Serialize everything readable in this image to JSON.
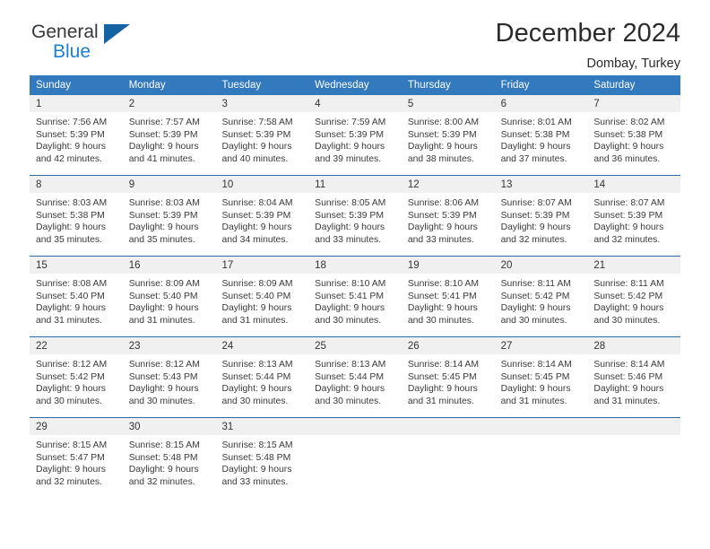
{
  "brand": {
    "name_top": "General",
    "name_bottom": "Blue",
    "accent_color": "#1b7fd4",
    "triangle_color": "#1464a5"
  },
  "header": {
    "title": "December 2024",
    "subtitle": "Dombay, Turkey"
  },
  "calendar": {
    "header_bg": "#3279bd",
    "row_border_color": "#2d6ca8",
    "daynum_bg": "#f0f0f0",
    "weekday_headers": [
      "Sunday",
      "Monday",
      "Tuesday",
      "Wednesday",
      "Thursday",
      "Friday",
      "Saturday"
    ],
    "weeks": [
      [
        {
          "day": "1",
          "sunrise": "Sunrise: 7:56 AM",
          "sunset": "Sunset: 5:39 PM",
          "daylight_1": "Daylight: 9 hours",
          "daylight_2": "and 42 minutes."
        },
        {
          "day": "2",
          "sunrise": "Sunrise: 7:57 AM",
          "sunset": "Sunset: 5:39 PM",
          "daylight_1": "Daylight: 9 hours",
          "daylight_2": "and 41 minutes."
        },
        {
          "day": "3",
          "sunrise": "Sunrise: 7:58 AM",
          "sunset": "Sunset: 5:39 PM",
          "daylight_1": "Daylight: 9 hours",
          "daylight_2": "and 40 minutes."
        },
        {
          "day": "4",
          "sunrise": "Sunrise: 7:59 AM",
          "sunset": "Sunset: 5:39 PM",
          "daylight_1": "Daylight: 9 hours",
          "daylight_2": "and 39 minutes."
        },
        {
          "day": "5",
          "sunrise": "Sunrise: 8:00 AM",
          "sunset": "Sunset: 5:39 PM",
          "daylight_1": "Daylight: 9 hours",
          "daylight_2": "and 38 minutes."
        },
        {
          "day": "6",
          "sunrise": "Sunrise: 8:01 AM",
          "sunset": "Sunset: 5:38 PM",
          "daylight_1": "Daylight: 9 hours",
          "daylight_2": "and 37 minutes."
        },
        {
          "day": "7",
          "sunrise": "Sunrise: 8:02 AM",
          "sunset": "Sunset: 5:38 PM",
          "daylight_1": "Daylight: 9 hours",
          "daylight_2": "and 36 minutes."
        }
      ],
      [
        {
          "day": "8",
          "sunrise": "Sunrise: 8:03 AM",
          "sunset": "Sunset: 5:38 PM",
          "daylight_1": "Daylight: 9 hours",
          "daylight_2": "and 35 minutes."
        },
        {
          "day": "9",
          "sunrise": "Sunrise: 8:03 AM",
          "sunset": "Sunset: 5:39 PM",
          "daylight_1": "Daylight: 9 hours",
          "daylight_2": "and 35 minutes."
        },
        {
          "day": "10",
          "sunrise": "Sunrise: 8:04 AM",
          "sunset": "Sunset: 5:39 PM",
          "daylight_1": "Daylight: 9 hours",
          "daylight_2": "and 34 minutes."
        },
        {
          "day": "11",
          "sunrise": "Sunrise: 8:05 AM",
          "sunset": "Sunset: 5:39 PM",
          "daylight_1": "Daylight: 9 hours",
          "daylight_2": "and 33 minutes."
        },
        {
          "day": "12",
          "sunrise": "Sunrise: 8:06 AM",
          "sunset": "Sunset: 5:39 PM",
          "daylight_1": "Daylight: 9 hours",
          "daylight_2": "and 33 minutes."
        },
        {
          "day": "13",
          "sunrise": "Sunrise: 8:07 AM",
          "sunset": "Sunset: 5:39 PM",
          "daylight_1": "Daylight: 9 hours",
          "daylight_2": "and 32 minutes."
        },
        {
          "day": "14",
          "sunrise": "Sunrise: 8:07 AM",
          "sunset": "Sunset: 5:39 PM",
          "daylight_1": "Daylight: 9 hours",
          "daylight_2": "and 32 minutes."
        }
      ],
      [
        {
          "day": "15",
          "sunrise": "Sunrise: 8:08 AM",
          "sunset": "Sunset: 5:40 PM",
          "daylight_1": "Daylight: 9 hours",
          "daylight_2": "and 31 minutes."
        },
        {
          "day": "16",
          "sunrise": "Sunrise: 8:09 AM",
          "sunset": "Sunset: 5:40 PM",
          "daylight_1": "Daylight: 9 hours",
          "daylight_2": "and 31 minutes."
        },
        {
          "day": "17",
          "sunrise": "Sunrise: 8:09 AM",
          "sunset": "Sunset: 5:40 PM",
          "daylight_1": "Daylight: 9 hours",
          "daylight_2": "and 31 minutes."
        },
        {
          "day": "18",
          "sunrise": "Sunrise: 8:10 AM",
          "sunset": "Sunset: 5:41 PM",
          "daylight_1": "Daylight: 9 hours",
          "daylight_2": "and 30 minutes."
        },
        {
          "day": "19",
          "sunrise": "Sunrise: 8:10 AM",
          "sunset": "Sunset: 5:41 PM",
          "daylight_1": "Daylight: 9 hours",
          "daylight_2": "and 30 minutes."
        },
        {
          "day": "20",
          "sunrise": "Sunrise: 8:11 AM",
          "sunset": "Sunset: 5:42 PM",
          "daylight_1": "Daylight: 9 hours",
          "daylight_2": "and 30 minutes."
        },
        {
          "day": "21",
          "sunrise": "Sunrise: 8:11 AM",
          "sunset": "Sunset: 5:42 PM",
          "daylight_1": "Daylight: 9 hours",
          "daylight_2": "and 30 minutes."
        }
      ],
      [
        {
          "day": "22",
          "sunrise": "Sunrise: 8:12 AM",
          "sunset": "Sunset: 5:42 PM",
          "daylight_1": "Daylight: 9 hours",
          "daylight_2": "and 30 minutes."
        },
        {
          "day": "23",
          "sunrise": "Sunrise: 8:12 AM",
          "sunset": "Sunset: 5:43 PM",
          "daylight_1": "Daylight: 9 hours",
          "daylight_2": "and 30 minutes."
        },
        {
          "day": "24",
          "sunrise": "Sunrise: 8:13 AM",
          "sunset": "Sunset: 5:44 PM",
          "daylight_1": "Daylight: 9 hours",
          "daylight_2": "and 30 minutes."
        },
        {
          "day": "25",
          "sunrise": "Sunrise: 8:13 AM",
          "sunset": "Sunset: 5:44 PM",
          "daylight_1": "Daylight: 9 hours",
          "daylight_2": "and 30 minutes."
        },
        {
          "day": "26",
          "sunrise": "Sunrise: 8:14 AM",
          "sunset": "Sunset: 5:45 PM",
          "daylight_1": "Daylight: 9 hours",
          "daylight_2": "and 31 minutes."
        },
        {
          "day": "27",
          "sunrise": "Sunrise: 8:14 AM",
          "sunset": "Sunset: 5:45 PM",
          "daylight_1": "Daylight: 9 hours",
          "daylight_2": "and 31 minutes."
        },
        {
          "day": "28",
          "sunrise": "Sunrise: 8:14 AM",
          "sunset": "Sunset: 5:46 PM",
          "daylight_1": "Daylight: 9 hours",
          "daylight_2": "and 31 minutes."
        }
      ],
      [
        {
          "day": "29",
          "sunrise": "Sunrise: 8:15 AM",
          "sunset": "Sunset: 5:47 PM",
          "daylight_1": "Daylight: 9 hours",
          "daylight_2": "and 32 minutes."
        },
        {
          "day": "30",
          "sunrise": "Sunrise: 8:15 AM",
          "sunset": "Sunset: 5:48 PM",
          "daylight_1": "Daylight: 9 hours",
          "daylight_2": "and 32 minutes."
        },
        {
          "day": "31",
          "sunrise": "Sunrise: 8:15 AM",
          "sunset": "Sunset: 5:48 PM",
          "daylight_1": "Daylight: 9 hours",
          "daylight_2": "and 33 minutes."
        },
        {
          "day": "",
          "sunrise": "",
          "sunset": "",
          "daylight_1": "",
          "daylight_2": ""
        },
        {
          "day": "",
          "sunrise": "",
          "sunset": "",
          "daylight_1": "",
          "daylight_2": ""
        },
        {
          "day": "",
          "sunrise": "",
          "sunset": "",
          "daylight_1": "",
          "daylight_2": ""
        },
        {
          "day": "",
          "sunrise": "",
          "sunset": "",
          "daylight_1": "",
          "daylight_2": ""
        }
      ]
    ]
  }
}
